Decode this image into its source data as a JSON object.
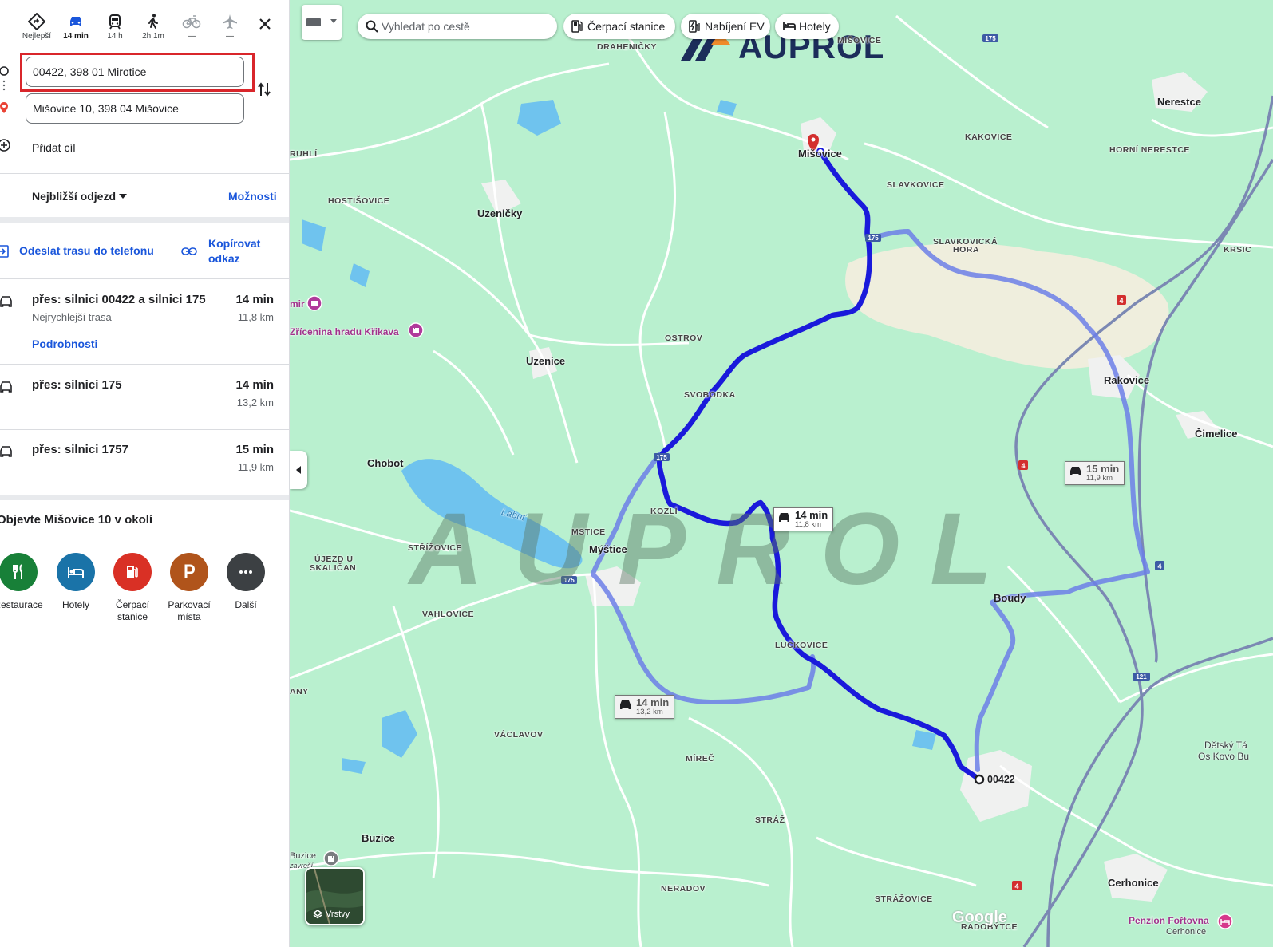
{
  "travel_modes": [
    {
      "label": "Nejlepší",
      "icon": "best-route-icon",
      "active": false
    },
    {
      "label": "14 min",
      "icon": "car-icon",
      "active": true
    },
    {
      "label": "14 h",
      "icon": "train-icon",
      "active": false
    },
    {
      "label": "2h 1m",
      "icon": "walk-icon",
      "active": false
    },
    {
      "label": "—",
      "icon": "bike-icon",
      "active": false
    },
    {
      "label": "—",
      "icon": "plane-icon",
      "active": false
    }
  ],
  "directions": {
    "origin": "00422, 398 01 Mirotice",
    "destination": "Mišovice 10, 398 04 Mišovice",
    "add_destination": "Přidat cíl",
    "departure": "Nejbližší odjezd",
    "options": "Možnosti",
    "send_to_phone": "Odeslat trasu do telefonu",
    "copy_link_1": "Kopírovat",
    "copy_link_2": "odkaz"
  },
  "routes": [
    {
      "title": "přes: silnici 00422 a silnici 175",
      "time": "14 min",
      "distance": "11,8 km",
      "subtitle": "Nejrychlejší trasa",
      "link": "Podrobnosti"
    },
    {
      "title": "přes: silnici 175",
      "time": "14 min",
      "distance": "13,2 km"
    },
    {
      "title": "přes: silnici 1757",
      "time": "15 min",
      "distance": "11,9 km"
    }
  ],
  "explore": {
    "title": "Objevte Mišovice 10 v okolí",
    "categories": [
      {
        "label": "Restaurace",
        "color": "#188038"
      },
      {
        "label": "Hotely",
        "color": "#1a73a8"
      },
      {
        "label": "Čerpací stanice",
        "line1": "Čerpací",
        "line2": "stanice",
        "color": "#d93025"
      },
      {
        "label": "Parkovací místa",
        "line1": "Parkovací",
        "line2": "místa",
        "color": "#b0541b"
      },
      {
        "label": "Další",
        "color": "#3c4043"
      }
    ]
  },
  "map": {
    "search_placeholder": "Vyhledat po cestě",
    "chips": [
      "Čerpací stanice",
      "Nabíjení EV",
      "Hotely"
    ],
    "layers_label": "Vrstvy",
    "watermark": "AUPROL",
    "logo": "AUPROL",
    "google": "Google",
    "route_labels": [
      {
        "time": "14 min",
        "distance": "11,8 km"
      },
      {
        "time": "14 min",
        "distance": "13,2 km"
      },
      {
        "time": "15 min",
        "distance": "11,9 km"
      }
    ],
    "places": {
      "draheničky": "DRAHENIČKY",
      "misovice": "Mišovice",
      "misovice_small": "MIŠOVICE",
      "nerestce": "Nerestce",
      "kakovice": "KAKOVICE",
      "horni_nerestce": "HORNÍ NERESTCE",
      "slavkovice": "SLAVKOVICE",
      "slavkovicka_hora_1": "SLAVKOVICKÁ",
      "slavkovicka_hora_2": "HORA",
      "krsic": "KRSIC",
      "ruhli": "RUHLÍ",
      "hostisovice": "HOSTIŠOVICE",
      "uzenicky": "Uzeničky",
      "zricenina": "Zřícenina hradu Křikava",
      "mir": "mir",
      "ostrov": "OSTROV",
      "uzenice": "Uzenice",
      "svobodka": "SVOBODKA",
      "rakovice": "Rakovice",
      "cimelice": "Čimelice",
      "chobot": "Chobot",
      "kozli": "KOZLÍ",
      "labut": "Labuť",
      "strizovice": "STŘÍŽOVICE",
      "mstice": "MSTICE",
      "mystice": "Mýštice",
      "ujezd_1": "ÚJEZD U",
      "ujezd_2": "SKALIČAN",
      "vahlovice": "VAHLOVICE",
      "boudy": "Boudy",
      "luckovice": "LUČKOVICE",
      "any": "ANY",
      "vaclavov": "VÁCLAVOV",
      "mirec": "MÍREČ",
      "destination_code": "00422",
      "detsky_1": "Dětský Tá",
      "detsky_2": "Os Kovo Bu",
      "straz": "STRÁŽ",
      "buzice": "Buzice",
      "buzice_small": "Buzice",
      "zavresi": "zavreší",
      "neradov": "NERADOV",
      "strazovice": "STRÁŽOVICE",
      "radobytce": "RADOBÝTCE",
      "cerhonice": "Cerhonice",
      "penzion": "Penzion Fořtovna",
      "cerhonice_small": "Cerhonice"
    },
    "road_shields": [
      "175",
      "175",
      "175",
      "175",
      "4",
      "4",
      "4",
      "4",
      "121"
    ]
  }
}
